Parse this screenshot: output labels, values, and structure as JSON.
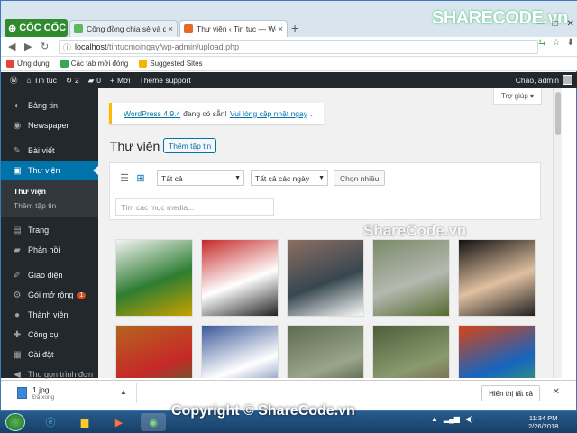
{
  "browser": {
    "brand": "CỐC CỐC",
    "tabs": [
      {
        "label": "Cộng đồng chia sẻ và dow"
      },
      {
        "label": "Thư viện ‹ Tin tuc — Word"
      }
    ],
    "new_tab": "+",
    "url_host": "localhost",
    "url_path": "/tintucmoingay/wp-admin/upload.php",
    "bookmarks": [
      {
        "label": "Ứng dụng",
        "color": "#e94235"
      },
      {
        "label": "Các tab mới đóng",
        "color": "#34a853"
      },
      {
        "label": "Suggested Sites",
        "color": "#f4b400"
      }
    ]
  },
  "watermark_top": "SHARECODE.vn",
  "adminbar": {
    "site": "Tin tuc",
    "updates": "2",
    "comments": "0",
    "new": "Mới",
    "theme_support": "Theme support",
    "greeting": "Chào, admin"
  },
  "sidebar": {
    "items": [
      {
        "label": "Bảng tin",
        "icon": "dashboard-icon",
        "glyph": "◐"
      },
      {
        "label": "Newspaper",
        "icon": "newspaper-icon",
        "glyph": "◉"
      },
      {
        "label": "Bài viết",
        "icon": "pin-icon",
        "glyph": "✎"
      },
      {
        "label": "Thư viện",
        "icon": "media-icon",
        "glyph": "▣"
      },
      {
        "label": "Trang",
        "icon": "page-icon",
        "glyph": "▤"
      },
      {
        "label": "Phản hồi",
        "icon": "comment-icon",
        "glyph": "▰"
      },
      {
        "label": "Giao diện",
        "icon": "appearance-icon",
        "glyph": "✐"
      },
      {
        "label": "Gói mở rộng",
        "icon": "plugin-icon",
        "glyph": "⚙"
      },
      {
        "label": "Thành viên",
        "icon": "users-icon",
        "glyph": "●"
      },
      {
        "label": "Công cụ",
        "icon": "tools-icon",
        "glyph": "✚"
      },
      {
        "label": "Cài đặt",
        "icon": "settings-icon",
        "glyph": "▦"
      },
      {
        "label": "Thu gọn trình đơn",
        "icon": "collapse-icon",
        "glyph": "◀"
      }
    ],
    "submenu": [
      "Thư viện",
      "Thêm tập tin"
    ],
    "plugin_badge": "1"
  },
  "help": "Trợ giúp ▾",
  "notice": {
    "link1": "WordPress 4.9.4",
    "mid": "đang có sẵn!",
    "link2": "Vui lòng cập nhật ngay",
    "end": "."
  },
  "page_title": "Thư viện",
  "add_new": "Thêm tập tin",
  "filters": {
    "type": "Tất cả",
    "date": "Tất cả các ngày",
    "bulk": "Chọn nhiều",
    "search_placeholder": "Tìm các mục media..."
  },
  "watermark_mid": "ShareCode.vn",
  "media": [
    {
      "colors": [
        "#f2f2f2",
        "#2e7d32",
        "#c8a000"
      ]
    },
    {
      "colors": [
        "#c62828",
        "#fff",
        "#222"
      ]
    },
    {
      "colors": [
        "#8d6e63",
        "#37474f",
        "#fafafa"
      ]
    },
    {
      "colors": [
        "#7a8a68",
        "#b5b8b0",
        "#556b2f"
      ]
    },
    {
      "colors": [
        "#111",
        "#e0c0a0",
        "#222"
      ]
    },
    {
      "colors": [
        "#b5651d",
        "#c62828",
        "#2e7d32"
      ]
    },
    {
      "colors": [
        "#3b5998",
        "#fff",
        "#3b5998"
      ]
    },
    {
      "colors": [
        "#5d6b4f",
        "#9aa58c",
        "#2f3d22"
      ]
    },
    {
      "colors": [
        "#4e5e3a",
        "#8a9a6e",
        "#6b4f3a"
      ]
    },
    {
      "colors": [
        "#d84315",
        "#1565c0",
        "#4caf50"
      ]
    }
  ],
  "download": {
    "filename": "1.jpg",
    "status": "Đã xong",
    "show_all": "Hiển thị tất cả"
  },
  "watermark_bottom": "Copyright © ShareCode.vn",
  "clock": {
    "time": "11:34 PM",
    "date": "2/26/2018"
  }
}
